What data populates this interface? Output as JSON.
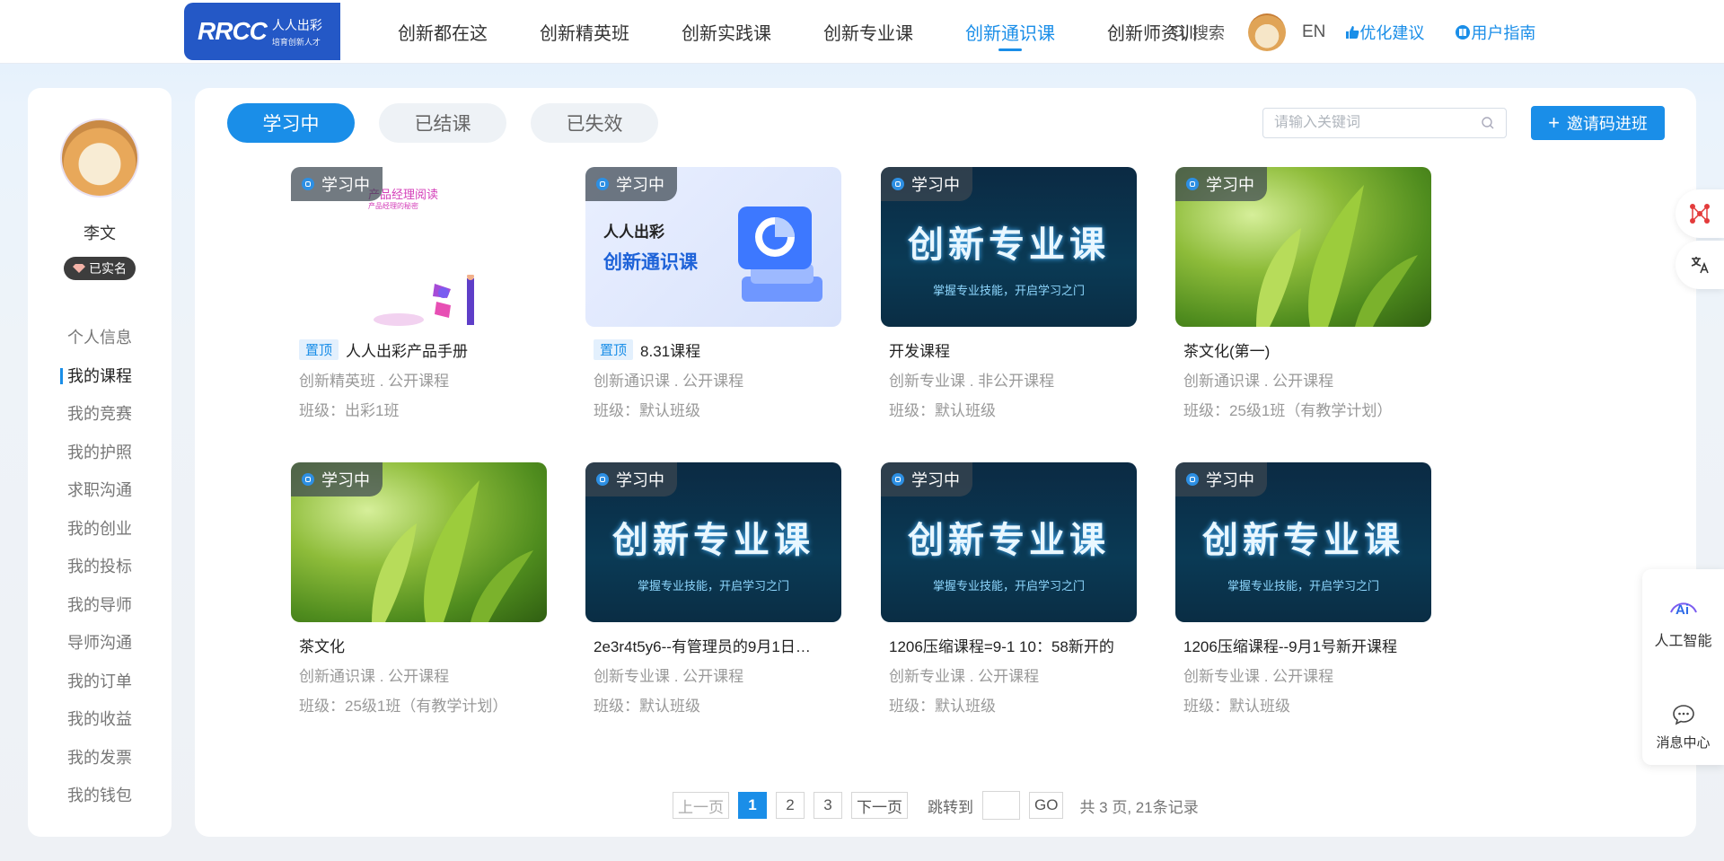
{
  "header": {
    "logo_mark": "RRCC",
    "logo_name": "人人出彩",
    "logo_slogan": "培育创新人才",
    "nav": [
      {
        "label": "创新都在这"
      },
      {
        "label": "创新精英班"
      },
      {
        "label": "创新实践课"
      },
      {
        "label": "创新专业课"
      },
      {
        "label": "创新通识课",
        "active": true
      },
      {
        "label": "创新师资训"
      }
    ],
    "search_label": "搜索",
    "lang_label": "EN",
    "feedback_label": "优化建议",
    "guide_label": "用户指南"
  },
  "sidebar": {
    "user_name": "李文",
    "verified_label": "已实名",
    "menu": [
      {
        "label": "个人信息"
      },
      {
        "label": "我的课程",
        "active": true
      },
      {
        "label": "我的竞赛"
      },
      {
        "label": "我的护照"
      },
      {
        "label": "求职沟通"
      },
      {
        "label": "我的创业"
      },
      {
        "label": "我的投标"
      },
      {
        "label": "我的导师"
      },
      {
        "label": "导师沟通"
      },
      {
        "label": "我的订单"
      },
      {
        "label": "我的收益"
      },
      {
        "label": "我的发票"
      },
      {
        "label": "我的钱包"
      }
    ]
  },
  "main": {
    "tabs": [
      {
        "label": "学习中",
        "active": true
      },
      {
        "label": "已结课"
      },
      {
        "label": "已失效"
      }
    ],
    "search_placeholder": "请输入关键词",
    "invite_label": "邀请码进班",
    "courses": [
      {
        "status": "学习中",
        "pin": "置顶",
        "title": "人人出彩产品手册",
        "meta": "创新精英班 . 公开课程",
        "class": "班级：出彩1班",
        "thumb": "product-manual",
        "thumb_text_1": "产品经理阅读",
        "thumb_text_2": "产品经理的秘密"
      },
      {
        "status": "学习中",
        "pin": "置顶",
        "title": "8.31课程",
        "meta": "创新通识课 . 公开课程",
        "class": "班级：默认班级",
        "thumb": "general-course",
        "thumb_text_1": "人人出彩",
        "thumb_text_2": "创新通识课"
      },
      {
        "status": "学习中",
        "pin": "",
        "title": "开发课程",
        "meta": "创新专业课 . 非公开课程",
        "class": "班级：默认班级",
        "thumb": "major-course",
        "thumb_text_1": "创新专业课",
        "thumb_text_2": "掌握专业技能，开启学习之门"
      },
      {
        "status": "学习中",
        "pin": "",
        "title": "茶文化(第一)",
        "meta": "创新通识课 . 公开课程",
        "class": "班级：25级1班（有教学计划）",
        "thumb": "tea"
      },
      {
        "status": "学习中",
        "pin": "",
        "title": "茶文化",
        "meta": "创新通识课 . 公开课程",
        "class": "班级：25级1班（有教学计划）",
        "thumb": "tea"
      },
      {
        "status": "学习中",
        "pin": "",
        "title": "2e3r4t5y6--有管理员的9月1日…",
        "meta": "创新专业课 . 公开课程",
        "class": "班级：默认班级",
        "thumb": "major-course",
        "thumb_text_1": "创新专业课",
        "thumb_text_2": "掌握专业技能，开启学习之门"
      },
      {
        "status": "学习中",
        "pin": "",
        "title": "1206压缩课程=9-1 10：58新开的",
        "meta": "创新专业课 . 公开课程",
        "class": "班级：默认班级",
        "thumb": "major-course",
        "thumb_text_1": "创新专业课",
        "thumb_text_2": "掌握专业技能，开启学习之门"
      },
      {
        "status": "学习中",
        "pin": "",
        "title": "1206压缩课程--9月1号新开课程",
        "meta": "创新专业课 . 公开课程",
        "class": "班级：默认班级",
        "thumb": "major-course",
        "thumb_text_1": "创新专业课",
        "thumb_text_2": "掌握专业技能，开启学习之门"
      }
    ],
    "pagination": {
      "prev": "上一页",
      "pages": [
        "1",
        "2",
        "3"
      ],
      "current": "1",
      "next": "下一页",
      "jump_label": "跳转到",
      "go": "GO",
      "total": "共 3 页, 21条记录"
    }
  },
  "float": {
    "ai_label": "人工智能",
    "msg_label": "消息中心"
  },
  "colors": {
    "accent": "#1a8ee8",
    "brand": "#2458c6"
  }
}
